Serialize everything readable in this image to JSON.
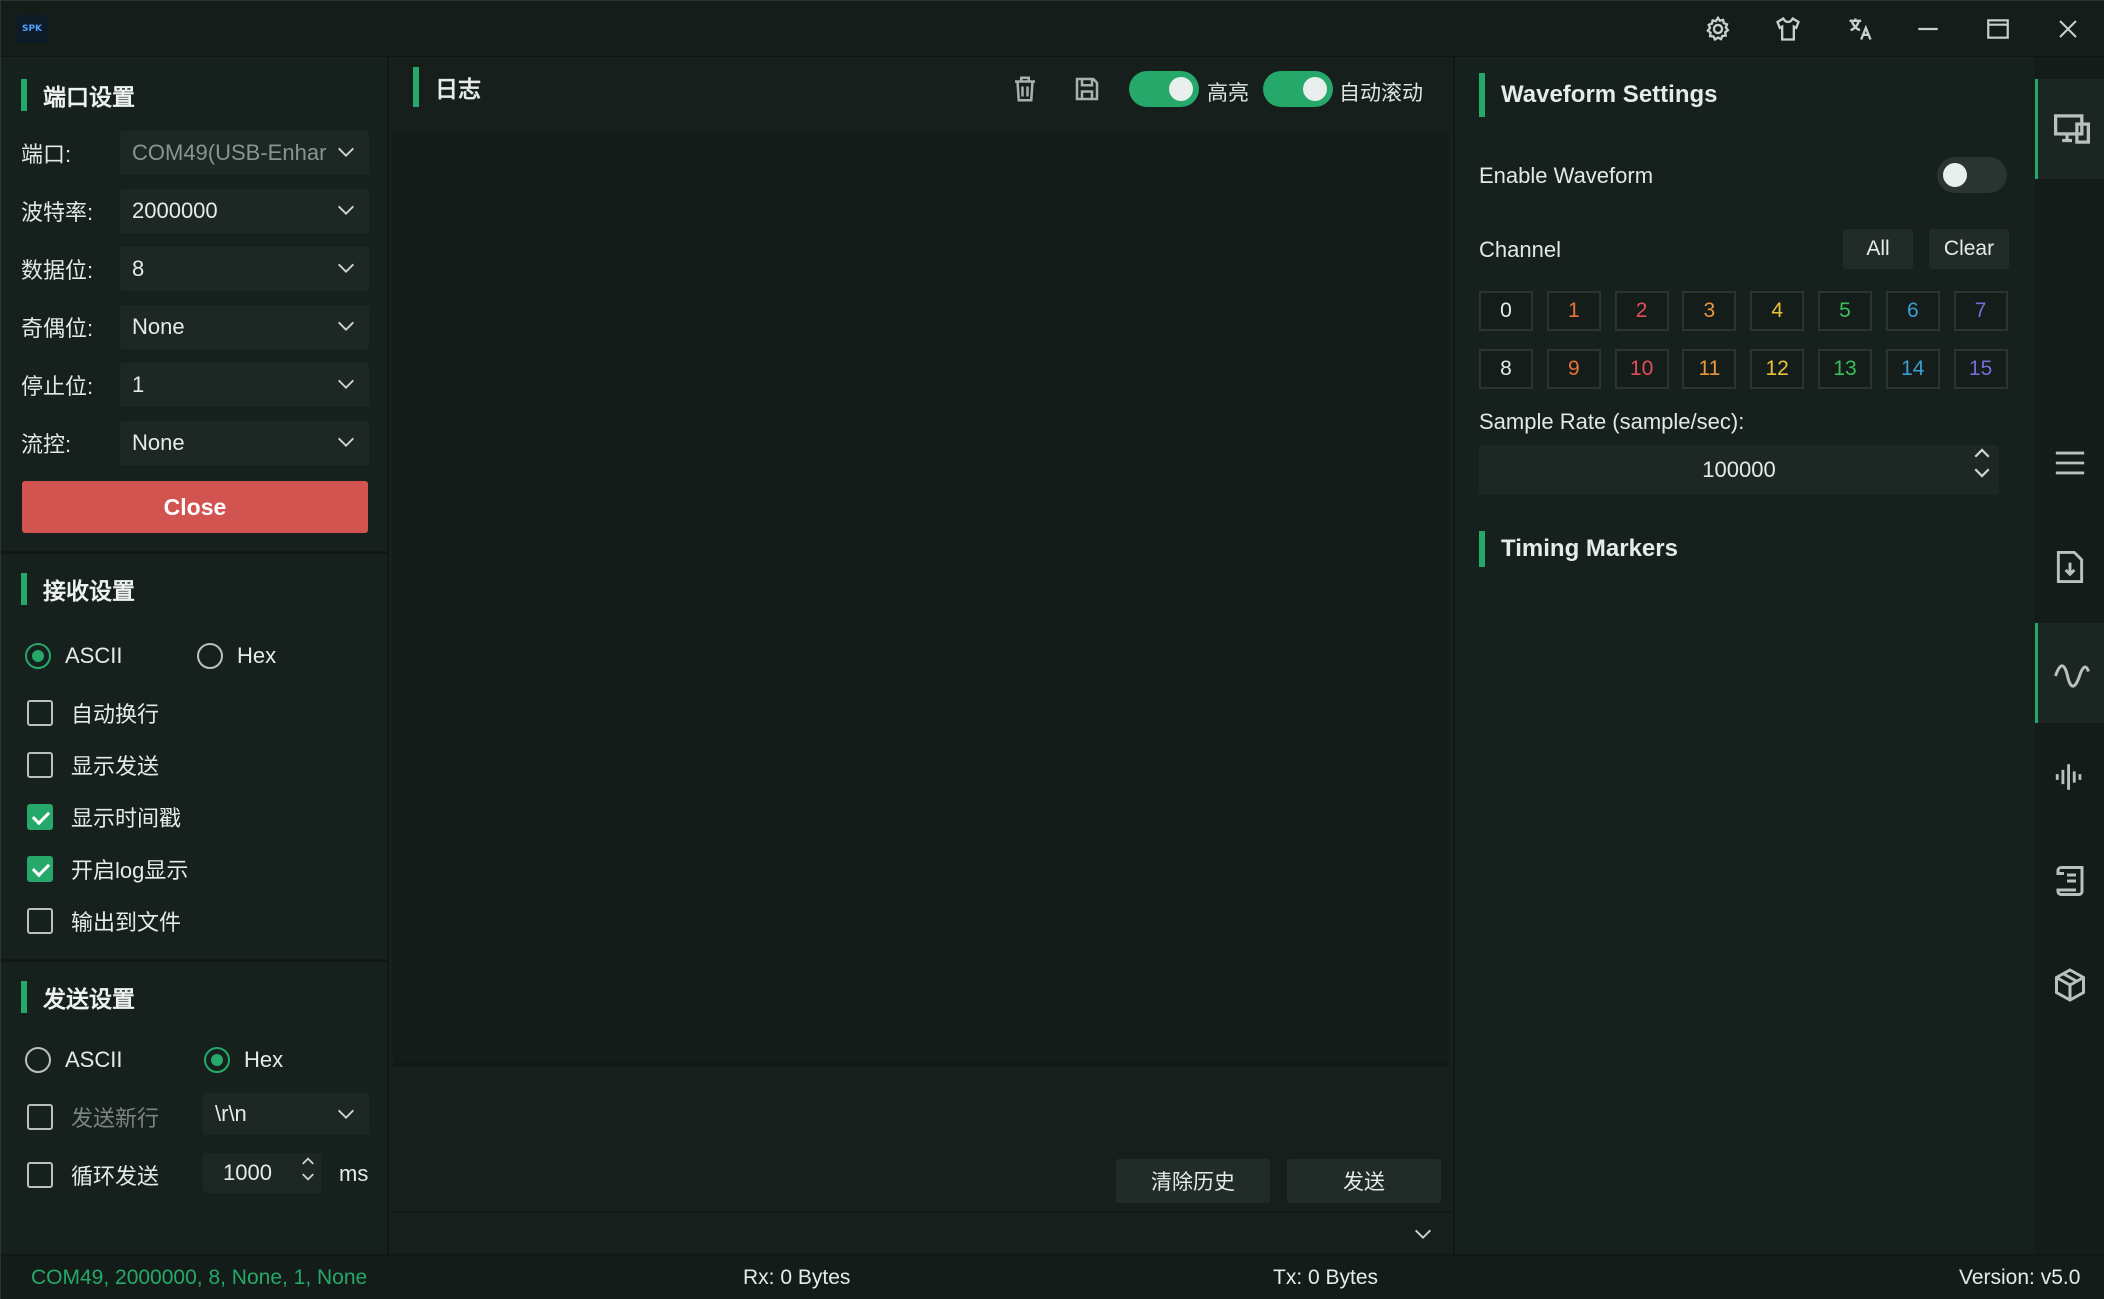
{
  "app": {
    "logo_text": "SPK"
  },
  "titlebar": {
    "icons": [
      "gear-icon",
      "shirt-icon",
      "translate-icon",
      "minimize-icon",
      "maximize-icon",
      "close-icon"
    ]
  },
  "port_settings": {
    "title": "端口设置",
    "fields": [
      {
        "label": "端口:",
        "value": "COM49(USB-Enhar"
      },
      {
        "label": "波特率:",
        "value": "2000000"
      },
      {
        "label": "数据位:",
        "value": "8"
      },
      {
        "label": "奇偶位:",
        "value": "None"
      },
      {
        "label": "停止位:",
        "value": "1"
      },
      {
        "label": "流控:",
        "value": "None"
      }
    ],
    "close_label": "Close"
  },
  "receive_settings": {
    "title": "接收设置",
    "mode_ascii": "ASCII",
    "mode_hex": "Hex",
    "selected_mode": "ASCII",
    "options": [
      {
        "label": "自动换行",
        "checked": false
      },
      {
        "label": "显示发送",
        "checked": false
      },
      {
        "label": "显示时间戳",
        "checked": true
      },
      {
        "label": "开启log显示",
        "checked": true
      },
      {
        "label": "输出到文件",
        "checked": false
      }
    ]
  },
  "send_settings": {
    "title": "发送设置",
    "mode_ascii": "ASCII",
    "mode_hex": "Hex",
    "selected_mode": "Hex",
    "newline_label": "发送新行",
    "newline_value": "\\r\\n",
    "loop_label": "循环发送",
    "loop_interval": "1000",
    "loop_unit": "ms"
  },
  "log": {
    "title": "日志",
    "highlight_label": "高亮",
    "autoscroll_label": "自动滚动",
    "highlight_on": true,
    "autoscroll_on": true,
    "clear_history_label": "清除历史",
    "send_label": "发送"
  },
  "waveform": {
    "title": "Waveform Settings",
    "enable_label": "Enable Waveform",
    "enabled": false,
    "channel_label": "Channel",
    "all_label": "All",
    "clear_label": "Clear",
    "channels": [
      {
        "n": "0",
        "color": "#e6ebe8"
      },
      {
        "n": "1",
        "color": "#e8743b"
      },
      {
        "n": "2",
        "color": "#e04e5a"
      },
      {
        "n": "3",
        "color": "#e8973b"
      },
      {
        "n": "4",
        "color": "#e8c23b"
      },
      {
        "n": "5",
        "color": "#3bbf5a"
      },
      {
        "n": "6",
        "color": "#3b9ed8"
      },
      {
        "n": "7",
        "color": "#7a6ad8"
      },
      {
        "n": "8",
        "color": "#e6ebe8"
      },
      {
        "n": "9",
        "color": "#e8743b"
      },
      {
        "n": "10",
        "color": "#e04e5a"
      },
      {
        "n": "11",
        "color": "#e8973b"
      },
      {
        "n": "12",
        "color": "#e8c23b"
      },
      {
        "n": "13",
        "color": "#3bbf5a"
      },
      {
        "n": "14",
        "color": "#3b9ed8"
      },
      {
        "n": "15",
        "color": "#7a6ad8"
      }
    ],
    "sample_rate_label": "Sample Rate (sample/sec):",
    "sample_rate": "100000",
    "timing_title": "Timing Markers"
  },
  "rail": {
    "items": [
      "devices-icon",
      "menu-icon",
      "download-file-icon",
      "waveform-icon",
      "audio-bars-icon",
      "script-icon",
      "package-icon"
    ],
    "active": "waveform-icon"
  },
  "status": {
    "connection": "COM49, 2000000, 8, None, 1, None",
    "rx": "Rx: 0 Bytes",
    "tx": "Tx: 0 Bytes",
    "version": "Version: v5.0",
    "accent": "#25a86a"
  }
}
